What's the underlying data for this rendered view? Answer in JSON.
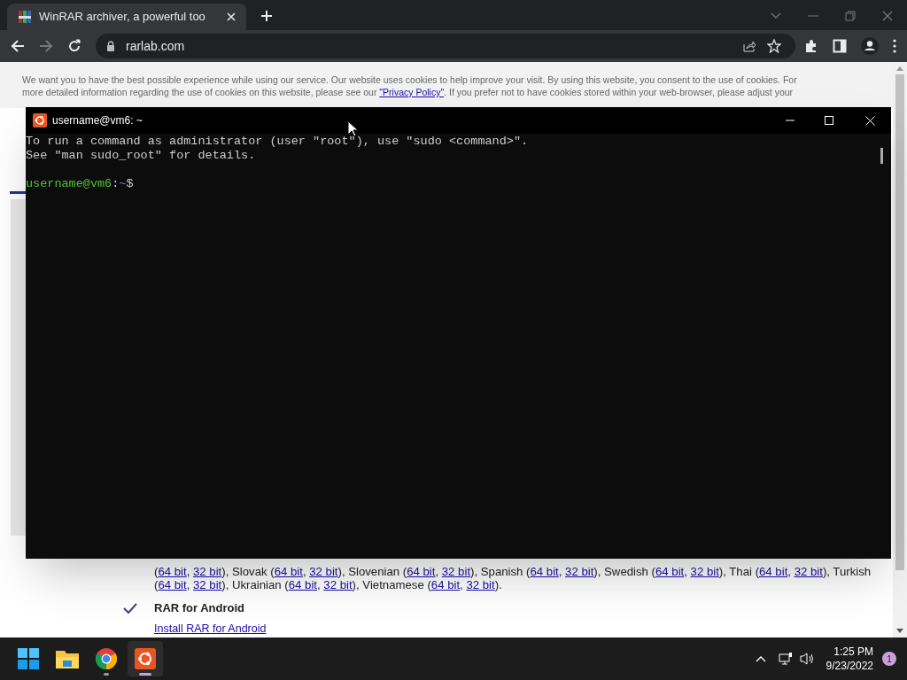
{
  "browser": {
    "tab": {
      "title": "WinRAR archiver, a powerful too",
      "selected": true
    },
    "address": "rarlab.com"
  },
  "page": {
    "cookie_notice": [
      "We want you to have the best possible experience while using our service. Our website uses cookies to help improve your visit. By using this website, you consent to the use of cookies. For",
      "more detailed information regarding the use of cookies on this website, please see our **\"Privacy Policy\"**. If you prefer not to have cookies stored within your web-browser, please adjust your"
    ],
    "language_lines": [
      [
        {
          "text": "(",
          "kind": "text"
        },
        {
          "text": "64 bit",
          "kind": "link"
        },
        {
          "text": ", ",
          "kind": "text"
        },
        {
          "text": "32 bit",
          "kind": "link"
        },
        {
          "text": "), Slovak (",
          "kind": "text"
        },
        {
          "text": "64 bit",
          "kind": "link"
        },
        {
          "text": ", ",
          "kind": "text"
        },
        {
          "text": "32 bit",
          "kind": "link"
        },
        {
          "text": "), Slovenian (",
          "kind": "text"
        },
        {
          "text": "64 bit",
          "kind": "link"
        },
        {
          "text": ", ",
          "kind": "text"
        },
        {
          "text": "32 bit",
          "kind": "link"
        },
        {
          "text": "), Spanish (",
          "kind": "text"
        },
        {
          "text": "64 bit",
          "kind": "link"
        },
        {
          "text": ", ",
          "kind": "text"
        },
        {
          "text": "32 bit",
          "kind": "link"
        },
        {
          "text": "), Swedish (",
          "kind": "text"
        },
        {
          "text": "64 bit",
          "kind": "link"
        },
        {
          "text": ", ",
          "kind": "text"
        },
        {
          "text": "32 bit",
          "kind": "link"
        },
        {
          "text": "), Thai (",
          "kind": "text"
        },
        {
          "text": "64 bit",
          "kind": "link"
        },
        {
          "text": ", ",
          "kind": "text"
        },
        {
          "text": "32 bit",
          "kind": "link"
        },
        {
          "text": "), Turkish",
          "kind": "text"
        }
      ],
      [
        {
          "text": "(",
          "kind": "text"
        },
        {
          "text": "64 bit",
          "kind": "link"
        },
        {
          "text": ", ",
          "kind": "text"
        },
        {
          "text": "32 bit",
          "kind": "link"
        },
        {
          "text": "), Ukrainian (",
          "kind": "text"
        },
        {
          "text": "64 bit",
          "kind": "link"
        },
        {
          "text": ", ",
          "kind": "text"
        },
        {
          "text": "32 bit",
          "kind": "link"
        },
        {
          "text": "), Vietnamese (",
          "kind": "text"
        },
        {
          "text": "64 bit",
          "kind": "link"
        },
        {
          "text": ", ",
          "kind": "text"
        },
        {
          "text": "32 bit",
          "kind": "link"
        },
        {
          "text": ").",
          "kind": "text"
        }
      ]
    ],
    "android": {
      "title": "RAR for Android",
      "checked": true,
      "link": "Install RAR for Android"
    }
  },
  "terminal": {
    "title": "username@vm6: ~",
    "lines": [
      "To run a command as administrator (user \"root\"), use \"sudo <command>\".",
      "See \"man sudo_root\" for details."
    ],
    "prompt": {
      "user": "username@vm6",
      "separator": ":",
      "path": "~",
      "symbol": "$"
    }
  },
  "taskbar": {
    "apps": [
      {
        "kind": "start",
        "selected": false
      },
      {
        "kind": "files",
        "selected": false
      },
      {
        "kind": "chrome",
        "selected": false
      },
      {
        "kind": "ubuntu",
        "selected": true
      }
    ],
    "time": "1:25 PM",
    "date": "9/23/2022",
    "notifications": "1"
  }
}
